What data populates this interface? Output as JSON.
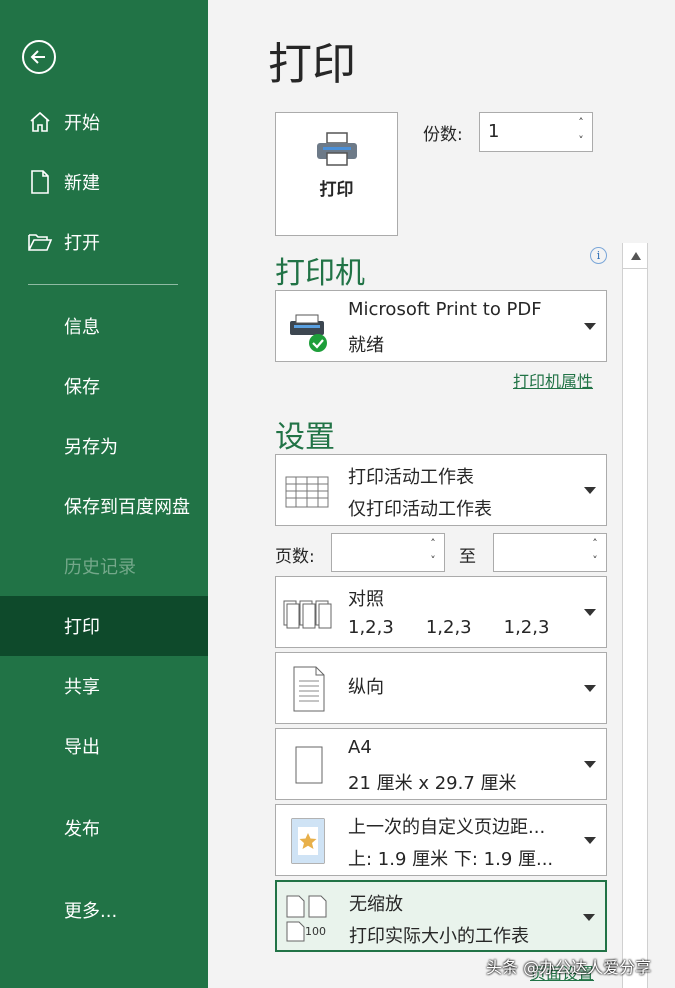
{
  "sidebar": {
    "items": [
      {
        "label": "开始"
      },
      {
        "label": "新建"
      },
      {
        "label": "打开"
      },
      {
        "label": "信息"
      },
      {
        "label": "保存"
      },
      {
        "label": "另存为"
      },
      {
        "label": "保存到百度网盘"
      },
      {
        "label": "历史记录"
      },
      {
        "label": "打印"
      },
      {
        "label": "共享"
      },
      {
        "label": "导出"
      },
      {
        "label": "发布"
      },
      {
        "label": "更多..."
      }
    ],
    "active": "打印",
    "accent": "#217346",
    "active_bg": "#0e4a2b"
  },
  "main": {
    "title": "打印",
    "print_button_label": "打印",
    "copies_label": "份数:",
    "copies_value": "1",
    "printer": {
      "heading": "打印机",
      "name": "Microsoft Print to PDF",
      "status": "就绪",
      "properties_link": "打印机属性"
    },
    "settings": {
      "heading": "设置",
      "scope": {
        "line1": "打印活动工作表",
        "line2": "仅打印活动工作表"
      },
      "pages_label": "页数:",
      "pages_to_label": "至",
      "collate": {
        "line1": "对照",
        "seq": [
          "1,2,3",
          "1,2,3",
          "1,2,3"
        ]
      },
      "orientation": {
        "line1": "纵向"
      },
      "paper": {
        "line1": "A4",
        "line2": "21 厘米 x 29.7 厘米"
      },
      "margins": {
        "line1": "上一次的自定义页边距...",
        "line2": "上: 1.9 厘米 下: 1.9 厘..."
      },
      "scaling": {
        "line1": "无缩放",
        "line2": "打印实际大小的工作表",
        "icon_text": "100"
      },
      "page_setup_link": "页面设置"
    }
  },
  "watermark": "头条 @办公达人爱分享"
}
